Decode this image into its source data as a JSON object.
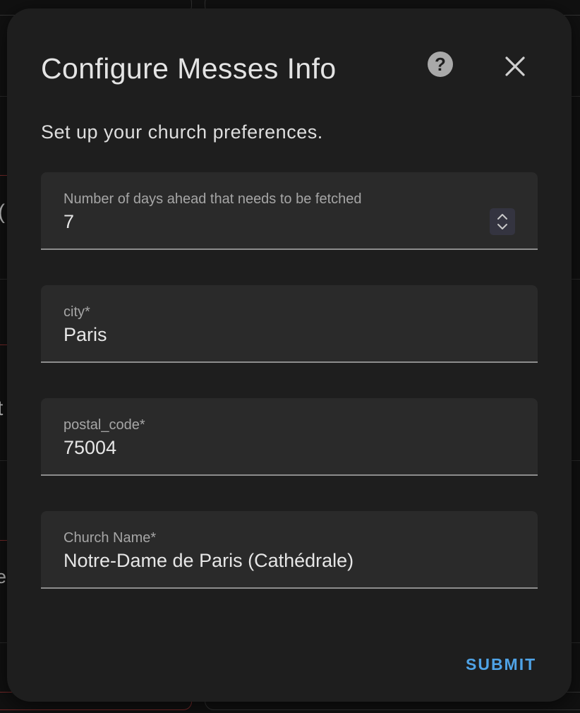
{
  "dialog": {
    "title": "Configure Messes Info",
    "subtitle": "Set up your church preferences.",
    "help_icon_glyph": "?",
    "help_icon": "help-circle-icon",
    "close_icon": "close-icon",
    "submit_label": "SUBMIT"
  },
  "fields": {
    "days_ahead": {
      "label": "Number of days ahead that needs to be fetched",
      "value": "7"
    },
    "city": {
      "label": "city*",
      "value": "Paris"
    },
    "postal_code": {
      "label": "postal_code*",
      "value": "75004"
    },
    "church_name": {
      "label": "Church Name*",
      "value": "Notre-Dame de Paris (Cathédrale)"
    }
  },
  "background": {
    "fragments": [
      "(",
      "t",
      "el"
    ]
  },
  "colors": {
    "accent": "#4fa3e6",
    "dialog_bg": "#1e1e1e",
    "field_bg": "#2a2a2a",
    "page_bg": "#111111"
  }
}
